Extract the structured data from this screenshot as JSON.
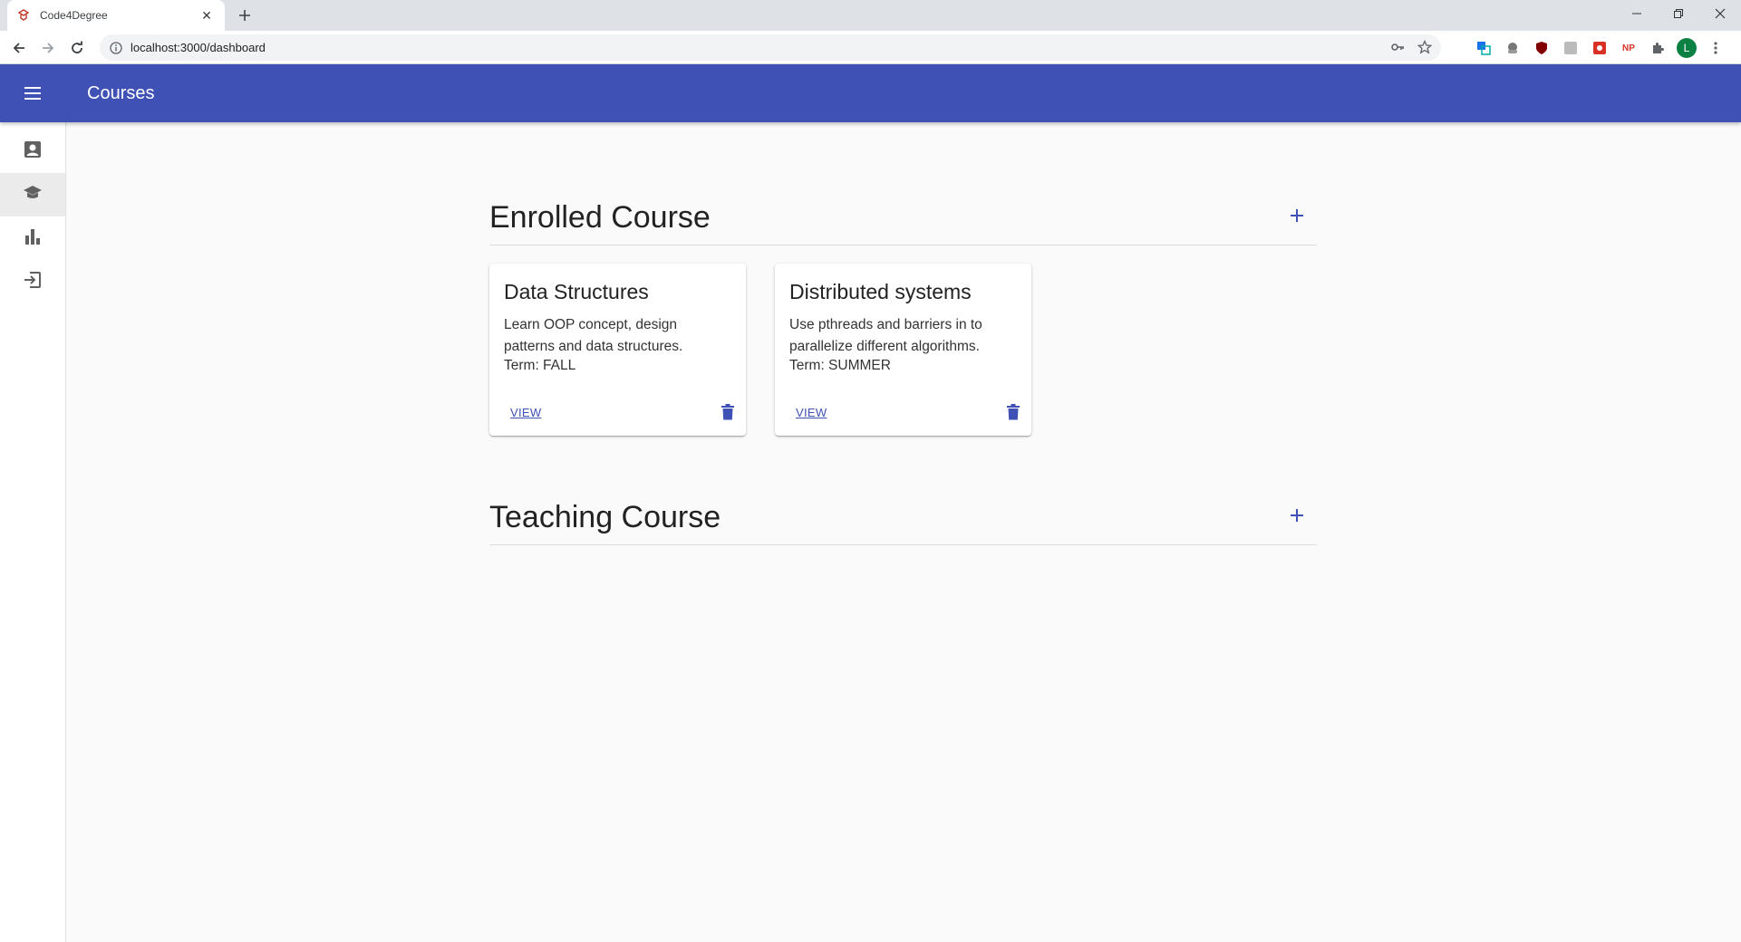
{
  "browser": {
    "tab_title": "Code4Degree",
    "url": "localhost:3000/dashboard",
    "profile_initial": "L"
  },
  "app": {
    "title": "Courses",
    "accent_color": "#3f51b5"
  },
  "sidebar": {
    "items": [
      {
        "icon": "account-box-icon"
      },
      {
        "icon": "school-icon",
        "active": true
      },
      {
        "icon": "bar-chart-icon"
      },
      {
        "icon": "exit-to-app-icon"
      }
    ]
  },
  "enrolled": {
    "title": "Enrolled Course",
    "courses": [
      {
        "name": "Data Structures",
        "description": "Learn OOP concept, design patterns and data structures.",
        "term": "Term: FALL",
        "action": "VIEW"
      },
      {
        "name": "Distributed systems",
        "description": "Use pthreads and barriers in to parallelize different algorithms.",
        "term": "Term: SUMMER",
        "action": "VIEW"
      }
    ]
  },
  "teaching": {
    "title": "Teaching Course"
  }
}
